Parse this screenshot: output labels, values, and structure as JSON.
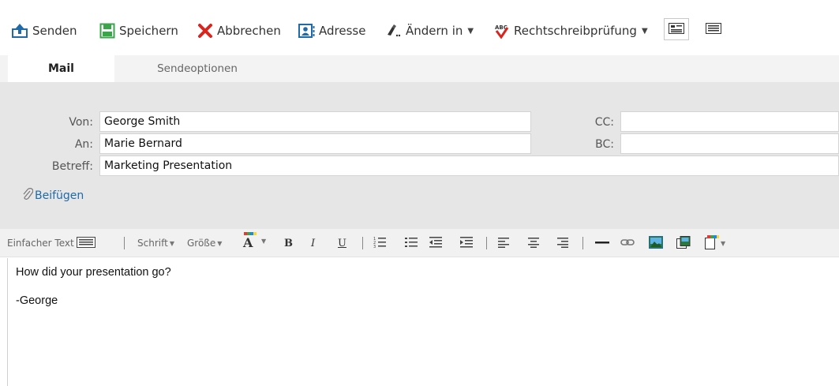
{
  "toolbar": {
    "send": "Senden",
    "save": "Speichern",
    "cancel": "Abbrechen",
    "address": "Adresse",
    "change_to": "Ändern in",
    "spellcheck": "Rechtschreibprüfung"
  },
  "tabs": {
    "mail": "Mail",
    "send_options": "Sendeoptionen"
  },
  "fields": {
    "from_label": "Von:",
    "from_value": "George Smith",
    "to_label": "An:",
    "to_value": "Marie Bernard",
    "subject_label": "Betreff:",
    "subject_value": "Marketing Presentation",
    "cc_label": "CC:",
    "cc_value": "",
    "bc_label": "BC:",
    "bc_value": ""
  },
  "attach": "Beifügen",
  "format": {
    "plain_text": "Einfacher Text",
    "font": "Schrift",
    "size": "Größe",
    "bold": "B",
    "italic": "I",
    "underline": "U"
  },
  "body": {
    "line1": "How did your presentation go?",
    "line2": "-George"
  },
  "colors": {
    "accent_blue": "#1f6aa8",
    "cancel_red": "#d8261f",
    "save_green": "#3aa54a",
    "header_bg": "#e6e6e6"
  }
}
